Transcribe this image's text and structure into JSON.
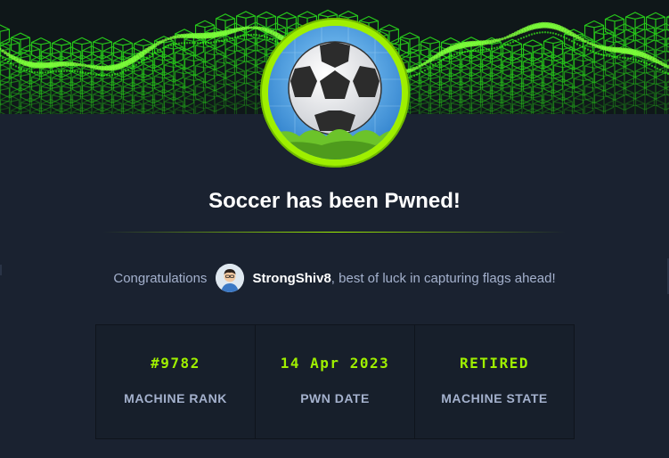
{
  "page": {
    "title": "Soccer has been Pwned!",
    "congrats_prefix": "Congratulations",
    "username": "StrongShiv8",
    "congrats_suffix": ", best of luck in capturing flags ahead!"
  },
  "stats": [
    {
      "value": "#9782",
      "label": "MACHINE RANK"
    },
    {
      "value": "14 Apr 2023",
      "label": "PWN DATE"
    },
    {
      "value": "RETIRED",
      "label": "MACHINE STATE"
    }
  ],
  "colors": {
    "accent": "#9fef00",
    "background": "#1a2230",
    "panel": "#171f2b",
    "muted_text": "#a4b1cd"
  },
  "icons": {
    "banner": "green-cube-wave-banner",
    "machine_avatar": "soccer-ball-icon",
    "user_avatar": "user-avatar-icon"
  }
}
